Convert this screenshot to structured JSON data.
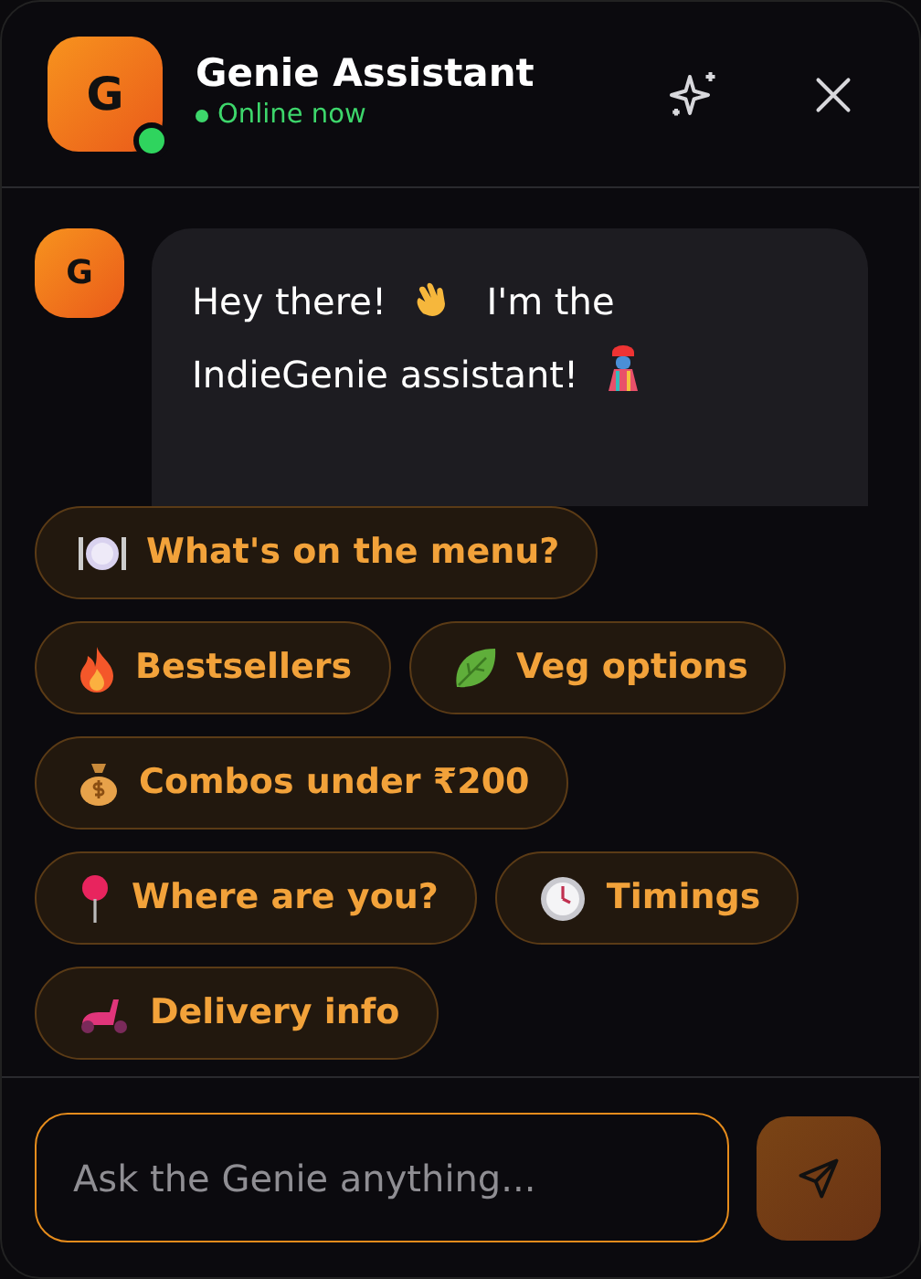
{
  "header": {
    "avatar": "G",
    "title": "Genie Assistant",
    "online": true,
    "status": "Online now"
  },
  "message": {
    "avatar": "G",
    "parts": [
      {
        "kind": "text",
        "text": "Hey there!"
      },
      {
        "kind": "wave"
      },
      {
        "kind": "text",
        "text": "I'm the"
      },
      {
        "kind": "break"
      },
      {
        "kind": "text",
        "text": "IndieGenie assistant!"
      },
      {
        "kind": "genie"
      }
    ]
  },
  "quick_replies": [
    {
      "kind": "plate",
      "label": "What's on the menu?"
    },
    {
      "kind": "fire",
      "label": "Bestsellers"
    },
    {
      "kind": "leaf",
      "label": "Veg options"
    },
    {
      "kind": "money",
      "label": "Combos under ₹200"
    },
    {
      "kind": "pin",
      "label": "Where are you?"
    },
    {
      "kind": "clock",
      "label": "Timings"
    },
    {
      "kind": "scooter",
      "label": "Delivery info"
    }
  ],
  "input": {
    "placeholder": "Ask the Genie anything..."
  }
}
